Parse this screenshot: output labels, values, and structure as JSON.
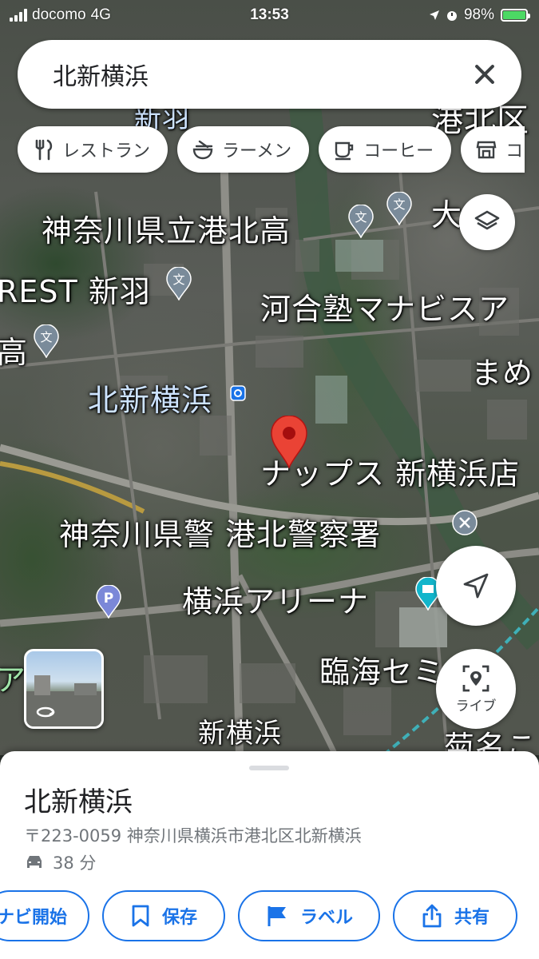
{
  "status_bar": {
    "carrier": "docomo",
    "network": "4G",
    "time": "13:53",
    "battery": "98%"
  },
  "search": {
    "query": "北新横浜"
  },
  "chips": [
    {
      "icon": "restaurant-icon",
      "label": "レストラン"
    },
    {
      "icon": "ramen-icon",
      "label": "ラーメン"
    },
    {
      "icon": "coffee-icon",
      "label": "コーヒー"
    },
    {
      "icon": "store-icon",
      "label": "コ"
    }
  ],
  "map": {
    "labels": {
      "top_right": "港北区",
      "top_left_station": "新羽",
      "school1": "神奈川県立港北高",
      "top_right2": "大山",
      "rest": "REST 新羽",
      "juku": "河合塾マナビスア",
      "school2": "高",
      "mame": "まめ",
      "station": "北新横浜",
      "naps": "ナップス 新横浜店",
      "police": "神奈川県警 港北警察署",
      "arena": "横浜アリーナ",
      "rinkai": "臨海セミナー",
      "shinyoko": "新横浜",
      "kikuna": "菊名こ",
      "left_edge": "ア"
    },
    "pin_color": "#ea4335"
  },
  "buttons": {
    "live_label": "ライブ"
  },
  "place": {
    "title": "北新横浜",
    "address": "〒223-0059 神奈川県横浜市港北区北新横浜",
    "travel_time": "38 分",
    "travel_mode_icon": "car-icon"
  },
  "actions": [
    {
      "icon": "navigation-icon",
      "label": "ナビ開始"
    },
    {
      "icon": "bookmark-icon",
      "label": "保存"
    },
    {
      "icon": "flag-icon",
      "label": "ラベル"
    },
    {
      "icon": "share-icon",
      "label": "共有"
    }
  ],
  "colors": {
    "accent": "#1a73e8",
    "pin": "#ea4335",
    "poi_school": "#7a8b9a",
    "poi_station": "#1a73e8",
    "poi_parking": "#7b88d8",
    "poi_arena": "#12b5cb"
  }
}
